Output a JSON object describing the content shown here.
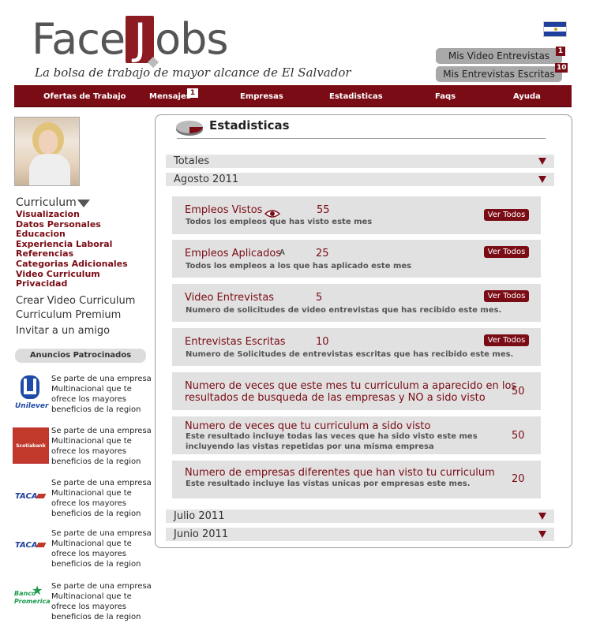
{
  "header": {
    "logo_pre": "Face",
    "logo_j": "J",
    "logo_post": "obs",
    "tagline": "La bolsa de trabajo de mayor alcance de El Salvador",
    "video_btn": "Mis Video Entrevistas",
    "video_badge": "1",
    "escritas_btn": "Mis Entrevistas Escritas",
    "escritas_badge": "10",
    "flag_colors": [
      "#1f3f9c",
      "#ffffff",
      "#1f3f9c"
    ]
  },
  "nav": {
    "items": [
      {
        "label": "Ofertas de Trabajo"
      },
      {
        "label": "Mensajes"
      },
      {
        "label": "Empresas"
      },
      {
        "label": "Estadisticas"
      },
      {
        "label": "Faqs"
      },
      {
        "label": "Ayuda"
      }
    ],
    "mensajes_badge": "1"
  },
  "sidebar": {
    "curriculum_title": "Curriculum",
    "curriculum_items": [
      "Visualizacion",
      "Datos Personales",
      "Educacion",
      "Experiencia Laboral",
      "Referencias",
      "Categorias Adicionales",
      "Video Curriculum",
      "Privacidad"
    ],
    "links": [
      "Crear Video Curriculum",
      "Curriculum Premium",
      "Invitar a un amigo"
    ],
    "ads_header": "Anuncios Patrocinados",
    "ads": [
      {
        "brand": "Unilever",
        "text": "Se parte de una empresa Multinacional que te ofrece los mayores beneficios de la region"
      },
      {
        "brand": "Scotiabank",
        "text": "Se parte de una empresa Multinacional que te ofrece los mayores beneficios de la region"
      },
      {
        "brand": "TACA",
        "text": "Se parte de una empresa Multinacional que te ofrece los mayores beneficios de la region"
      },
      {
        "brand": "TACA",
        "text": "Se parte de una empresa Multinacional que te ofrece los mayores beneficios de la region"
      },
      {
        "brand": "Banco Promerica",
        "text": "Se parte de una empresa Multinacional que te ofrece los mayores beneficios de la region"
      }
    ]
  },
  "main": {
    "title": "Estadisticas",
    "sections": [
      "Totales",
      "Agosto 2011",
      "Julio 2011",
      "Junio 2011"
    ],
    "cards": [
      {
        "title": "Empleos Vistos",
        "value": "55",
        "desc": "Todos los empleos que has visto este mes",
        "button": "Ver Todos"
      },
      {
        "title": "Empleos Aplicados",
        "icon": "A",
        "value": "25",
        "desc": "Todos los empleos a los que has aplicado este mes",
        "button": "Ver Todos"
      },
      {
        "title": "Video Entrevistas",
        "value": "5",
        "desc": "Numero de solicitudes de video entrevistas que has recibido este mes.",
        "button": "Ver Todos"
      },
      {
        "title": "Entrevistas Escritas",
        "value": "10",
        "desc": "Numero de Solicitudes de entrevistas escritas que has recibido este mes.",
        "button": "Ver Todos"
      },
      {
        "title_line1": "Numero de veces que este mes tu curriculum a aparecido en los",
        "title_line2": "resultados de busqueda de las empresas y NO a sido visto",
        "value": "50"
      },
      {
        "title": "Numero de veces que tu curriculum a sido visto",
        "desc_line1": "Este resultado incluye todas las veces que ha sido visto este mes",
        "desc_line2": " incluyendo las vistas repetidas por una misma empresa",
        "value": "50"
      },
      {
        "title": "Numero de empresas diferentes que han visto tu curriculum",
        "desc": "Este resultado incluye las vistas unicas por empresas este mes.",
        "value": "20"
      }
    ]
  }
}
